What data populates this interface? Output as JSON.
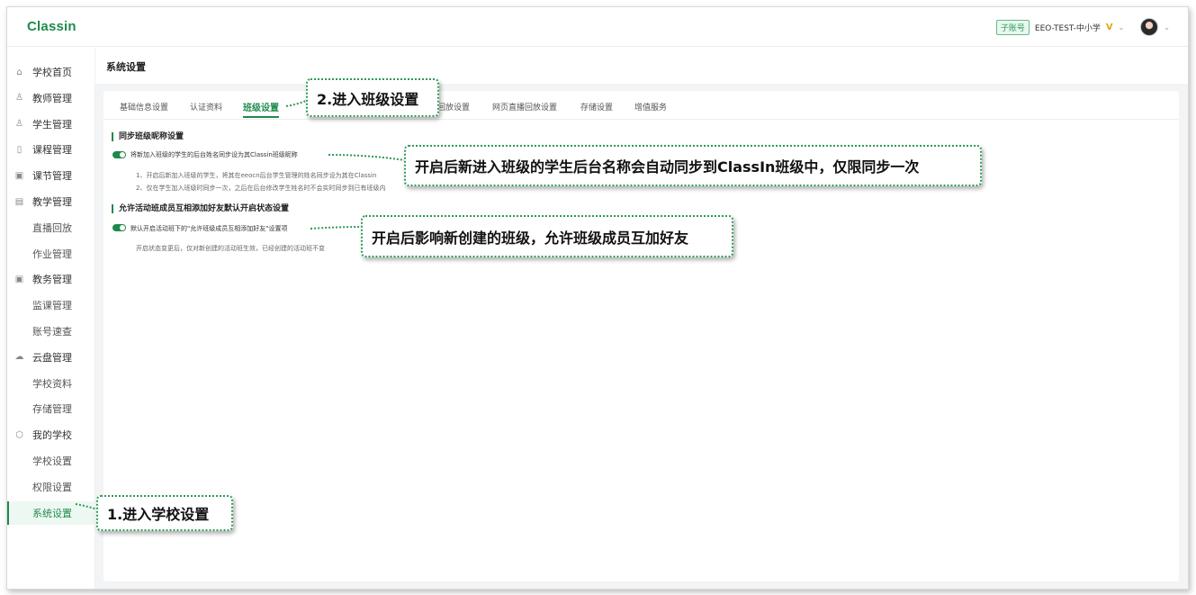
{
  "header": {
    "logo": "Classin",
    "account_badge": "子账号",
    "account_name": "EEO-TEST-中小学",
    "vip_mark": "V",
    "caret": "⌄"
  },
  "sidebar": {
    "items": [
      {
        "label": "学校首页",
        "icon": "home-icon",
        "glyph": "⌂"
      },
      {
        "label": "教师管理",
        "icon": "person-icon",
        "glyph": "♙"
      },
      {
        "label": "学生管理",
        "icon": "student-icon",
        "glyph": "♙"
      },
      {
        "label": "课程管理",
        "icon": "course-icon",
        "glyph": "▯"
      },
      {
        "label": "课节管理",
        "icon": "lesson-icon",
        "glyph": "▣"
      },
      {
        "label": "教学管理",
        "icon": "teaching-icon",
        "glyph": "▤"
      },
      {
        "label": "直播回放",
        "sub": true
      },
      {
        "label": "作业管理",
        "sub": true
      },
      {
        "label": "教务管理",
        "icon": "affairs-icon",
        "glyph": "▣"
      },
      {
        "label": "监课管理",
        "sub": true
      },
      {
        "label": "账号速查",
        "sub": true
      },
      {
        "label": "云盘管理",
        "icon": "cloud-icon",
        "glyph": "☁"
      },
      {
        "label": "学校资料",
        "sub": true
      },
      {
        "label": "存储管理",
        "sub": true
      },
      {
        "label": "我的学校",
        "icon": "school-icon",
        "glyph": "⬡"
      },
      {
        "label": "学校设置",
        "sub": true
      },
      {
        "label": "权限设置",
        "sub": true
      },
      {
        "label": "系统设置",
        "sub": true,
        "active": true
      }
    ]
  },
  "main": {
    "page_title": "系统设置",
    "tabs": [
      {
        "label": "基础信息设置"
      },
      {
        "label": "认证资料"
      },
      {
        "label": "班级设置",
        "active": true
      },
      {
        "label": "回放设置"
      },
      {
        "label": "网页直播回放设置"
      },
      {
        "label": "存储设置"
      },
      {
        "label": "增值服务"
      }
    ],
    "section1": {
      "title": "同步班级昵称设置",
      "option": "将新加入班级的学生的后台姓名同步设为其Classin班级昵称",
      "desc1": "1、开启后新加入班级的学生，将其在eeocn后台学生管理的姓名同步设为其在Classin",
      "desc2": "2、仅在学生加入班级时同步一次，之后在后台修改学生姓名时不会实时同步到已有班级内"
    },
    "section2": {
      "title": "允许活动班成员互相添加好友默认开启状态设置",
      "option": "默认开启活动班下的\"允许班级成员互相添加好友\"设置项",
      "desc": "开启状态变更后，仅对新创建的活动班生效，已经创建的活动班不变"
    }
  },
  "callouts": {
    "step2": "2.进入班级设置",
    "sync_note": "开启后新进入班级的学生后台名称会自动同步到ClassIn班级中，仅限同步一次",
    "friend_note": "开启后影响新创建的班级，允许班级成员互加好友",
    "step1": "1.进入学校设置"
  },
  "colors": {
    "accent": "#1f8a4c",
    "callout_border": "#2e9a56"
  }
}
